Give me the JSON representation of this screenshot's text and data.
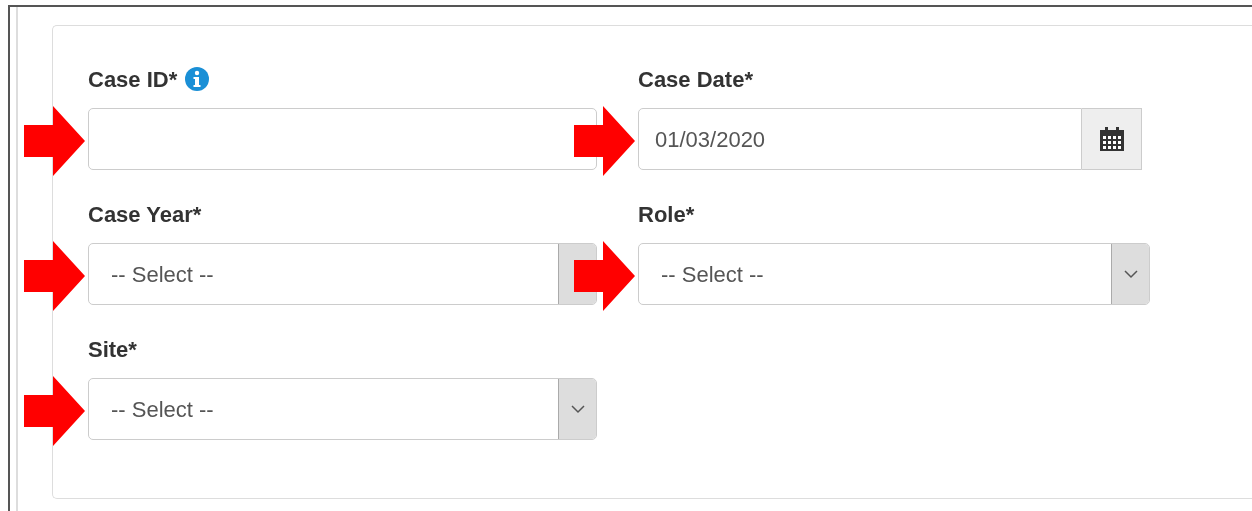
{
  "form": {
    "fields": [
      {
        "kind": "text",
        "label": "Case ID*",
        "info": true,
        "arrow": true
      },
      {
        "kind": "date",
        "label": "Case Date*",
        "info": false,
        "value": "01/03/2020",
        "arrow": true
      },
      {
        "kind": "select",
        "label": "Case Year*",
        "info": false,
        "value": "-- Select --",
        "arrow": true,
        "chevron_hidden": true
      },
      {
        "kind": "select",
        "label": "Role*",
        "info": false,
        "value": "-- Select --",
        "arrow": true,
        "chevron_hidden": false
      },
      {
        "kind": "select",
        "label": "Site*",
        "info": false,
        "value": "-- Select --",
        "arrow": true,
        "chevron_hidden": false
      }
    ]
  }
}
